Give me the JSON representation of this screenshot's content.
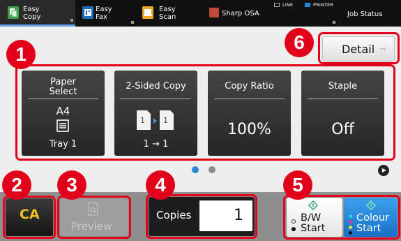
{
  "colors": {
    "callout": "#e2001a",
    "accent": "#5aa0e6",
    "tile_bg": "#353535",
    "ca_text": "#f0c020",
    "colour_start": "#2386dc"
  },
  "top_bar": {
    "tabs": [
      {
        "label": "Easy\nCopy",
        "icon": "easy-copy-icon",
        "active": true
      },
      {
        "label": "Easy\nFax",
        "icon": "easy-fax-icon",
        "active": false
      },
      {
        "label": "Easy\nScan",
        "icon": "easy-scan-icon",
        "active": false
      },
      {
        "label": "Sharp OSA",
        "icon": "sharp-osa-icon",
        "active": false
      }
    ],
    "indicators": [
      {
        "label": "LINE",
        "icon": "line-indicator-icon"
      },
      {
        "label": "PRINTER",
        "icon": "printer-indicator-icon"
      }
    ],
    "job_status": "Job Status"
  },
  "detail_button": {
    "label": "Detail",
    "icon": "arrow-right-icon"
  },
  "tiles": [
    {
      "header": "Paper\nSelect",
      "size": "A4",
      "tray": "Tray 1",
      "icon": "paper-tray-icon"
    },
    {
      "header": "2-Sided Copy",
      "mode": "1 → 1",
      "icon": "two-sided-copy-icon"
    },
    {
      "header": "Copy Ratio",
      "value": "100%"
    },
    {
      "header": "Staple",
      "value": "Off"
    }
  ],
  "pager": {
    "pages": 2,
    "current": 1,
    "next_icon": "next-page-icon"
  },
  "bottom": {
    "ca_label": "CA",
    "preview_label": "Preview",
    "preview_icon": "preview-icon",
    "copies_label": "Copies",
    "copies_value": "1",
    "bw_start": "B/W\nStart",
    "bw_icon": "bw-start-icon",
    "colour_start": "Colour\nStart",
    "colour_icon": "colour-start-icon"
  },
  "callouts": [
    "1",
    "2",
    "3",
    "4",
    "5",
    "6"
  ]
}
